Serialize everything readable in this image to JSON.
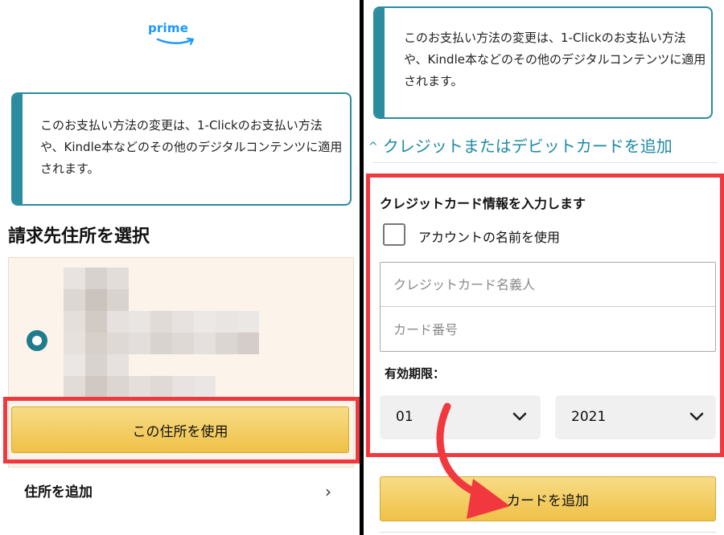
{
  "left": {
    "logo_text": "prime",
    "info_text": "このお支払い方法の変更は、1-Clickのお支払い方法や、Kindle本などのその他のデジタルコンテンツに適用されます。",
    "section_title": "請求先住所を選択",
    "use_address_label": "この住所を使用",
    "add_address_label": "住所を追加"
  },
  "right": {
    "info_text": "このお支払い方法の変更は、1-Clickのお支払い方法や、Kindle本などのその他のデジタルコンテンツに適用されます。",
    "collapse_link": "クレジットまたはデビットカードを追加",
    "form_title": "クレジットカード情報を入力します",
    "checkbox_label": "アカウントの名前を使用",
    "name_placeholder": "クレジットカード名義人",
    "card_placeholder": "カード番号",
    "expiry_label": "有効期限：",
    "month_value": "01",
    "year_value": "2021",
    "add_card_label": "カードを追加"
  },
  "colors": {
    "accent_teal": "#2a8c9e",
    "link_teal": "#1e8aa3",
    "highlight_red": "#f2383f",
    "button_yellow": "#f0c14b",
    "prime_blue": "#1a98ff"
  },
  "icons": {
    "chevron_right": "chevron-right-icon",
    "chevron_down": "chevron-down-icon",
    "caret_up": "caret-up-icon"
  }
}
